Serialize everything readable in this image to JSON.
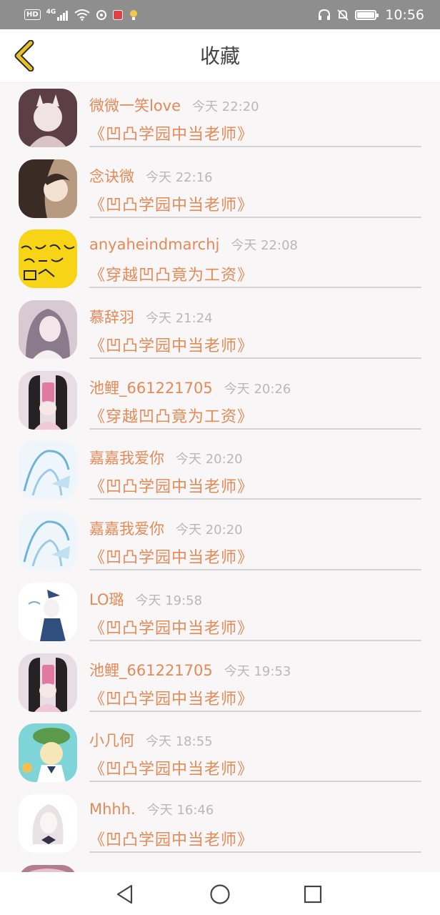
{
  "status_bar": {
    "left_badge": "HD",
    "network": "4G",
    "time": "10:56"
  },
  "header": {
    "title": "收藏"
  },
  "items": [
    {
      "name": "微微一笑love",
      "time": "今天 22:20",
      "book": "《凹凸学园中当老师》"
    },
    {
      "name": "念诀微",
      "time": "今天 22:16",
      "book": "《凹凸学园中当老师》"
    },
    {
      "name": "anyaheindmarchj",
      "time": "今天 22:08",
      "book": "《穿越凹凸竟为工资》"
    },
    {
      "name": "慕辞羽",
      "time": "今天 21:24",
      "book": "《凹凸学园中当老师》"
    },
    {
      "name": "池鲤_661221705",
      "time": "今天 20:26",
      "book": "《穿越凹凸竟为工资》"
    },
    {
      "name": "嘉嘉我爱你",
      "time": "今天 20:20",
      "book": "《凹凸学园中当老师》"
    },
    {
      "name": "嘉嘉我爱你",
      "time": "今天 20:20",
      "book": "《凹凸学园中当老师》"
    },
    {
      "name": "LO璐",
      "time": "今天 19:58",
      "book": "《凹凸学园中当老师》"
    },
    {
      "name": "池鲤_661221705",
      "time": "今天 19:53",
      "book": "《凹凸学园中当老师》"
    },
    {
      "name": "小几何",
      "time": "今天 18:55",
      "book": "《凹凸学园中当老师》"
    },
    {
      "name": "Mhhh.",
      "time": "今天 16:46",
      "book": "《凹凸学园中当老师》"
    }
  ],
  "colors": {
    "accent": "#e48a57",
    "back_icon": "#e7c02a",
    "time_text": "#b8b8b8"
  }
}
